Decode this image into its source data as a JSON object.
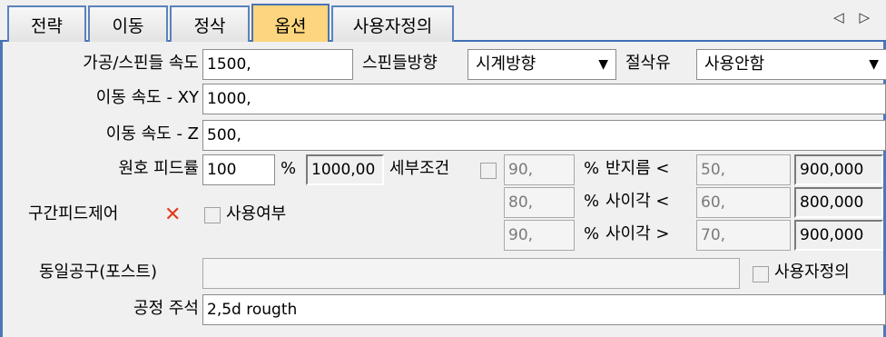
{
  "tabs": [
    {
      "label": "전략"
    },
    {
      "label": "이동"
    },
    {
      "label": "정삭"
    },
    {
      "label": "옵션"
    },
    {
      "label": "사용자정의"
    }
  ],
  "nav_arrows": "◁ ▷",
  "machining_speed": {
    "label": "가공/스핀들 속도",
    "value": "1500,"
  },
  "spindle_direction": {
    "label": "스핀들방향",
    "value": "시계방향"
  },
  "coolant": {
    "label": "절삭유",
    "value": "사용안함"
  },
  "move_speed_xy": {
    "label": "이동 속도 - XY",
    "value": "1000,"
  },
  "move_speed_z": {
    "label": "이동 속도 - Z",
    "value": "500,"
  },
  "arc_feed": {
    "label": "원호 피드률",
    "value": "100",
    "unit": "%",
    "result": "1000,00"
  },
  "detail_conditions": {
    "label": "세부조건",
    "rows": [
      {
        "percent": "90,",
        "unit": "%",
        "cond_label": "반지름 <",
        "cond_value": "50,",
        "result": "900,000"
      },
      {
        "percent": "80,",
        "unit": "%",
        "cond_label": "사이각 <",
        "cond_value": "60,",
        "result": "800,000"
      },
      {
        "percent": "90,",
        "unit": "%",
        "cond_label": "사이각 >",
        "cond_value": "70,",
        "result": "900,000"
      }
    ]
  },
  "section_feed_control": {
    "label": "구간피드제어",
    "use_label": "사용여부"
  },
  "same_tool": {
    "label": "동일공구(포스트)",
    "value": "",
    "custom_label": "사용자정의"
  },
  "process_note": {
    "label": "공정 주석",
    "value": "2,5d rougth"
  }
}
